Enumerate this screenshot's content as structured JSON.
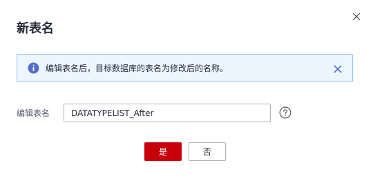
{
  "dialog": {
    "title": "新表名",
    "close_icon": "close-icon"
  },
  "alert": {
    "icon": "info-icon",
    "text": "编辑表名后，目标数据库的表名为修改后的名称。",
    "close_icon": "close-icon"
  },
  "form": {
    "label": "编辑表名",
    "value": "DATATYPELIST_After",
    "help_icon": "question-circle-icon"
  },
  "buttons": {
    "yes_label": "是",
    "no_label": "否"
  },
  "colors": {
    "primary": "#c7000b",
    "info": "#526ecc",
    "alert_bg": "#edf5ff"
  }
}
